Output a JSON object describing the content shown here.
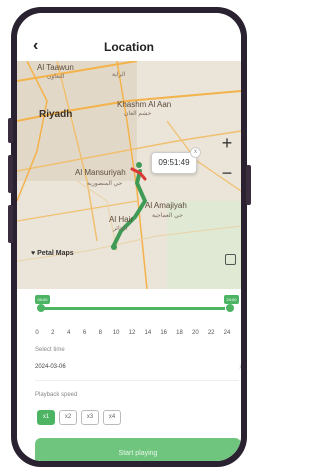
{
  "header": {
    "back_icon": "chevron-left-icon",
    "back_glyph": "‹",
    "title": "Location"
  },
  "map": {
    "places": {
      "al_taawun": "Al Taawun",
      "al_taawun_ar": "التعاون",
      "al_rayah_ar": "الراية",
      "riyadh": "Riyadh",
      "khashm": "Khashm Al Aan",
      "khashm_ar": "خشم العان",
      "mansuriyah": "Al Mansuriyah",
      "mansuriyah_ar": "حي المنصورية",
      "amajiyah": "Al Amajiyah",
      "amajiyah_ar": "حي العماجية",
      "al_hair": "Al Hair",
      "al_hair_ar": "الحائر"
    },
    "zoom_in": "+",
    "zoom_out": "−",
    "tooltip_time": "09:51:49",
    "tooltip_close": "x",
    "provider": "Petal Maps",
    "layers_icon": "layers-icon"
  },
  "timeline": {
    "start_chip": "00:00",
    "end_chip": "24:00",
    "ticks": [
      "0",
      "2",
      "4",
      "6",
      "8",
      "10",
      "12",
      "14",
      "16",
      "18",
      "20",
      "22",
      "24"
    ]
  },
  "select_time": {
    "label": "Select time",
    "value": "2024-03-06",
    "chevron": "›"
  },
  "playback_speed": {
    "label": "Playback speed",
    "options": [
      "x1",
      "x2",
      "x3",
      "x4"
    ],
    "selected": "x1"
  },
  "start_button": "Start playing",
  "colors": {
    "accent": "#4cb463",
    "route": "#3f9a55",
    "route_end": "#d93a36"
  }
}
